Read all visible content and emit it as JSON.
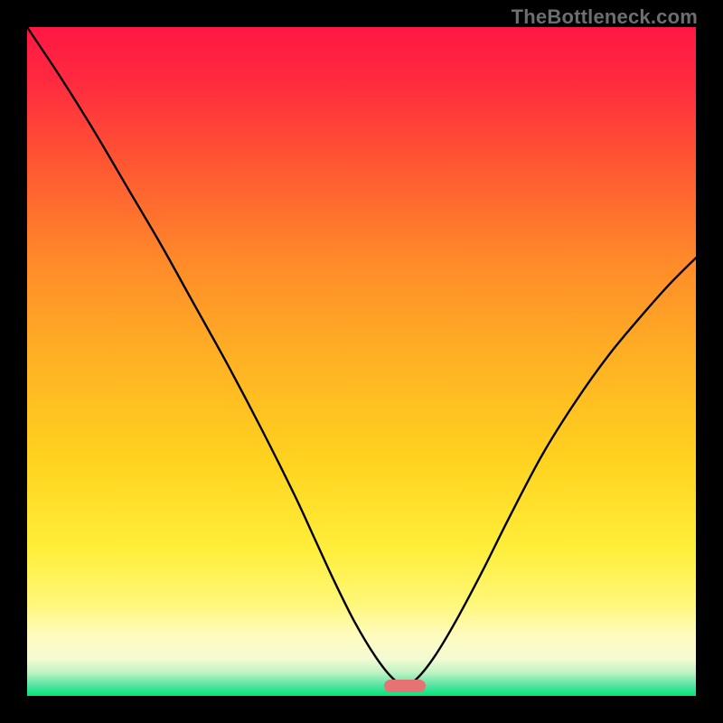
{
  "watermark": "TheBottleneck.com",
  "colors": {
    "background": "#000000",
    "gradient_stops": [
      {
        "offset": 0.0,
        "color": "#ff1744"
      },
      {
        "offset": 0.08,
        "color": "#ff2a3f"
      },
      {
        "offset": 0.2,
        "color": "#ff5533"
      },
      {
        "offset": 0.35,
        "color": "#ff8a2a"
      },
      {
        "offset": 0.5,
        "color": "#ffb224"
      },
      {
        "offset": 0.65,
        "color": "#ffd31f"
      },
      {
        "offset": 0.78,
        "color": "#ffee3a"
      },
      {
        "offset": 0.86,
        "color": "#fff777"
      },
      {
        "offset": 0.91,
        "color": "#fffbbf"
      },
      {
        "offset": 0.945,
        "color": "#f3fbd2"
      },
      {
        "offset": 0.965,
        "color": "#bff3c4"
      },
      {
        "offset": 0.985,
        "color": "#52e3a0"
      },
      {
        "offset": 1.0,
        "color": "#00e676"
      }
    ],
    "curve": "#000000",
    "marker": "#e57373"
  },
  "chart_data": {
    "type": "line",
    "title": "",
    "xlabel": "",
    "ylabel": "",
    "xlim": [
      0,
      1
    ],
    "ylim": [
      0,
      1
    ],
    "grid": false,
    "legend": false,
    "annotations": [
      "min-marker"
    ],
    "min_point": {
      "x": 0.565,
      "y": 0.015
    },
    "series": [
      {
        "name": "bottleneck-curve",
        "x": [
          0.0,
          0.05,
          0.1,
          0.15,
          0.2,
          0.25,
          0.3,
          0.35,
          0.4,
          0.43,
          0.46,
          0.49,
          0.52,
          0.545,
          0.565,
          0.585,
          0.61,
          0.64,
          0.68,
          0.72,
          0.77,
          0.82,
          0.87,
          0.92,
          0.96,
          1.0
        ],
        "y": [
          1.0,
          0.925,
          0.845,
          0.76,
          0.675,
          0.585,
          0.495,
          0.4,
          0.3,
          0.235,
          0.17,
          0.11,
          0.06,
          0.028,
          0.015,
          0.028,
          0.06,
          0.11,
          0.185,
          0.265,
          0.36,
          0.44,
          0.51,
          0.57,
          0.615,
          0.655
        ]
      }
    ]
  }
}
